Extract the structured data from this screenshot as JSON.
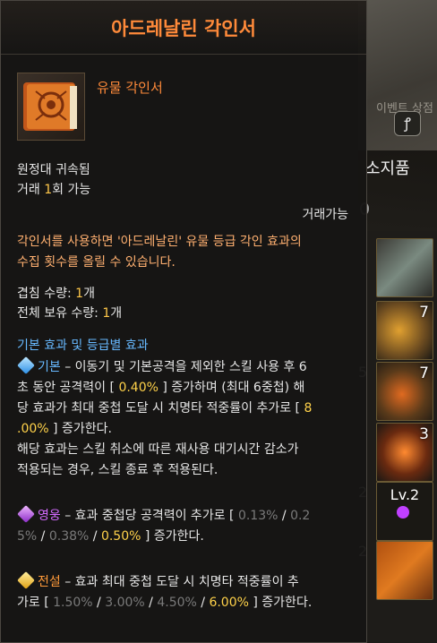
{
  "background": {
    "scene_tag": "이벤트 상점",
    "hook_glyph": "ꝭ",
    "inventory_title": "소지품",
    "slots": [
      {
        "count": ""
      },
      {
        "count": "7"
      },
      {
        "count": "7"
      },
      {
        "count": "3"
      },
      {
        "lv": "Lv.2"
      },
      {
        "count": ""
      }
    ],
    "edge_numbers": [
      "5",
      "2",
      "2"
    ]
  },
  "tooltip": {
    "title": "아드레날린 각인서",
    "grade": "유물 각인서",
    "bound": "원정대 귀속됨",
    "trade_prefix": "거래 ",
    "trade_num": "1",
    "trade_suffix": "회 가능",
    "tradable": "거래가능",
    "desc": {
      "p1": "각인서를 사용하면 '",
      "name": "아드레날린",
      "p2": "' 유물 등급 각인 효과의",
      "p3": "수집 횟수를 올릴 수 있습니다."
    },
    "stack_label": "겹침 수량: ",
    "stack_num": "1",
    "stack_unit": "개",
    "owned_label": "전체 보유 수량: ",
    "owned_num": "1",
    "owned_unit": "개",
    "effects_header": "기본 효과 및 등급별 효과",
    "basic": {
      "name": "기본",
      "t1": " – 이동기 및 기본공격을 제외한 스킬 사용 후 6",
      "t2": "초 동안 공격력이 [ ",
      "v1": "0.40%",
      "t3": " ] 증가하며 (최대 6중첩) 해",
      "t4": "당 효과가 최대 중첩 도달 시 치명타 적중률이 추가로 [ ",
      "v2a": "8",
      "v2b": ".00%",
      "t5": " ] 증가한다.",
      "t6": "해당 효과는 스킬 취소에 따른 재사용 대기시간 감소가",
      "t7": "적용되는 경우, 스킬 종료 후 적용된다."
    },
    "heroic": {
      "name": "영웅",
      "t1": " – 효과 중첩당 공격력이 추가로 [ ",
      "v1": "0.13%",
      "sep": " / ",
      "v2a": "0.2",
      "v2b": "5%",
      "v3": "0.38%",
      "v4": "0.50%",
      "t2": " ] 증가한다."
    },
    "legendary": {
      "name": "전설",
      "t1": " – 효과 최대 중첩 도달 시 치명타 적중률이 추",
      "t2": "가로 [ ",
      "v1": "1.50%",
      "v2": "3.00%",
      "v3": "4.50%",
      "v4": "6.00%",
      "t3": " ] 증가한다."
    }
  }
}
